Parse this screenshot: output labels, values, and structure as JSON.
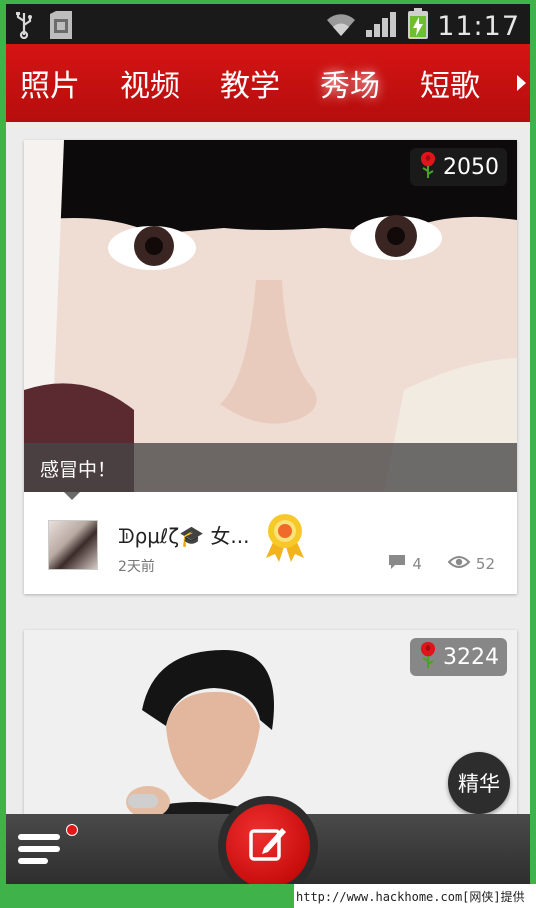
{
  "status_bar": {
    "time": "11:17",
    "icons": [
      "usb-icon",
      "sd-card-icon",
      "wifi-icon",
      "signal-icon",
      "battery-charging-icon"
    ]
  },
  "tabs": [
    {
      "label": "照片",
      "active": false
    },
    {
      "label": "视频",
      "active": false
    },
    {
      "label": "教学",
      "active": false
    },
    {
      "label": "秀场",
      "active": true
    },
    {
      "label": "短歌",
      "active": false
    }
  ],
  "feed": [
    {
      "roses": "2050",
      "caption": "感冒中！",
      "author": "ᗫρμℓζ🎓 女...",
      "time": "2天前",
      "comments": "4",
      "views": "52"
    },
    {
      "roses": "3224",
      "featured_label": "精华"
    }
  ],
  "watermark": "http://www.hackhome.com[网侠]提供",
  "colors": {
    "header_red": "#c81010",
    "compose_red": "#e01818",
    "bottom_bar": "#333333",
    "background": "#ececec"
  }
}
